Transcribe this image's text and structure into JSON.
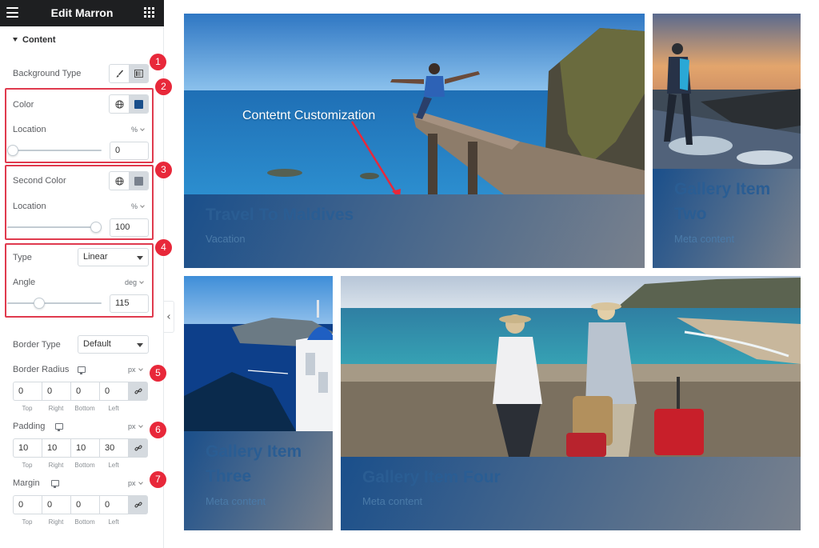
{
  "editor": {
    "title": "Edit Marron",
    "section_label": "Content",
    "background_type_label": "Background Type",
    "color": {
      "label": "Color",
      "value": "#1a4f8b",
      "location_label": "Location",
      "location_unit": "%",
      "location_value": "0",
      "location_fraction": 0
    },
    "second_color": {
      "label": "Second Color",
      "value": "#79818d",
      "location_label": "Location",
      "location_unit": "%",
      "location_value": "100",
      "location_fraction": 1
    },
    "type": {
      "label": "Type",
      "value": "Linear"
    },
    "angle": {
      "label": "Angle",
      "unit": "deg",
      "value": "115",
      "fraction": 0.32
    },
    "border_type": {
      "label": "Border Type",
      "value": "Default"
    },
    "border_radius": {
      "label": "Border Radius",
      "unit": "px",
      "values": [
        "0",
        "0",
        "0",
        "0"
      ]
    },
    "padding": {
      "label": "Padding",
      "unit": "px",
      "values": [
        "10",
        "10",
        "10",
        "30"
      ]
    },
    "margin": {
      "label": "Margin",
      "unit": "px",
      "values": [
        "0",
        "0",
        "0",
        "0"
      ]
    },
    "dim_labels": [
      "Top",
      "Right",
      "Bottom",
      "Left"
    ],
    "badges": [
      "1",
      "2",
      "3",
      "4",
      "5",
      "6",
      "7"
    ],
    "accent_red": "#e8283a"
  },
  "gallery": {
    "annotation": "Contetnt Customization",
    "items": [
      {
        "title": "Travel To Maldives",
        "meta": "Vacation"
      },
      {
        "title": "Gallery Item Two",
        "meta": "Meta content"
      },
      {
        "title": "Gallery Item Three",
        "meta": "Meta content"
      },
      {
        "title": "Gallery Item Four",
        "meta": "Meta content"
      }
    ]
  }
}
